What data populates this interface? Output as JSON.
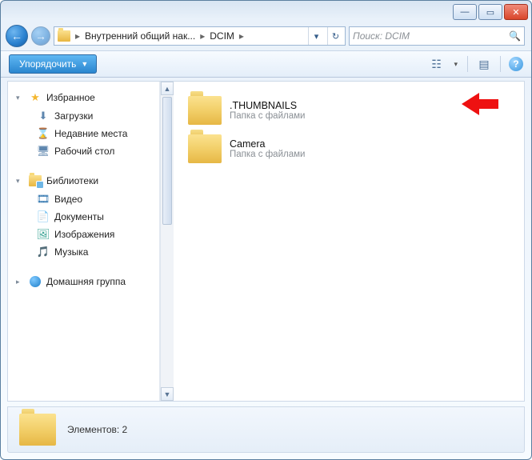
{
  "titlebar": {
    "minimize": "—",
    "maximize": "▭",
    "close": "✕"
  },
  "nav": {
    "back": "←",
    "forward": "→"
  },
  "breadcrumb": {
    "part1": "Внутренний общий нак...",
    "part2": "DCIM",
    "sep": "▸",
    "drop": "▾",
    "refresh": "↻"
  },
  "search": {
    "placeholder": "Поиск: DCIM",
    "icon": "🔍"
  },
  "toolbar": {
    "organize": "Упорядочить",
    "organize_arrow": "▼",
    "view_icon": "☷",
    "preview_icon": "▤",
    "help": "?"
  },
  "sidebar": {
    "favorites": {
      "label": "Избранное",
      "items": [
        {
          "icon": "⬇",
          "label": "Загрузки"
        },
        {
          "icon": "⌛",
          "label": "Недавние места"
        },
        {
          "icon": "🖥",
          "label": "Рабочий стол"
        }
      ]
    },
    "libraries": {
      "label": "Библиотеки",
      "items": [
        {
          "icon": "🎞",
          "label": "Видео"
        },
        {
          "icon": "📄",
          "label": "Документы"
        },
        {
          "icon": "🖼",
          "label": "Изображения"
        },
        {
          "icon": "🎵",
          "label": "Музыка"
        }
      ]
    },
    "homegroup": {
      "label": "Домашняя группа"
    }
  },
  "content": {
    "folders": [
      {
        "name": ".THUMBNAILS",
        "type": "Папка с файлами"
      },
      {
        "name": "Camera",
        "type": "Папка с файлами"
      }
    ]
  },
  "status": {
    "text": "Элементов: 2"
  }
}
